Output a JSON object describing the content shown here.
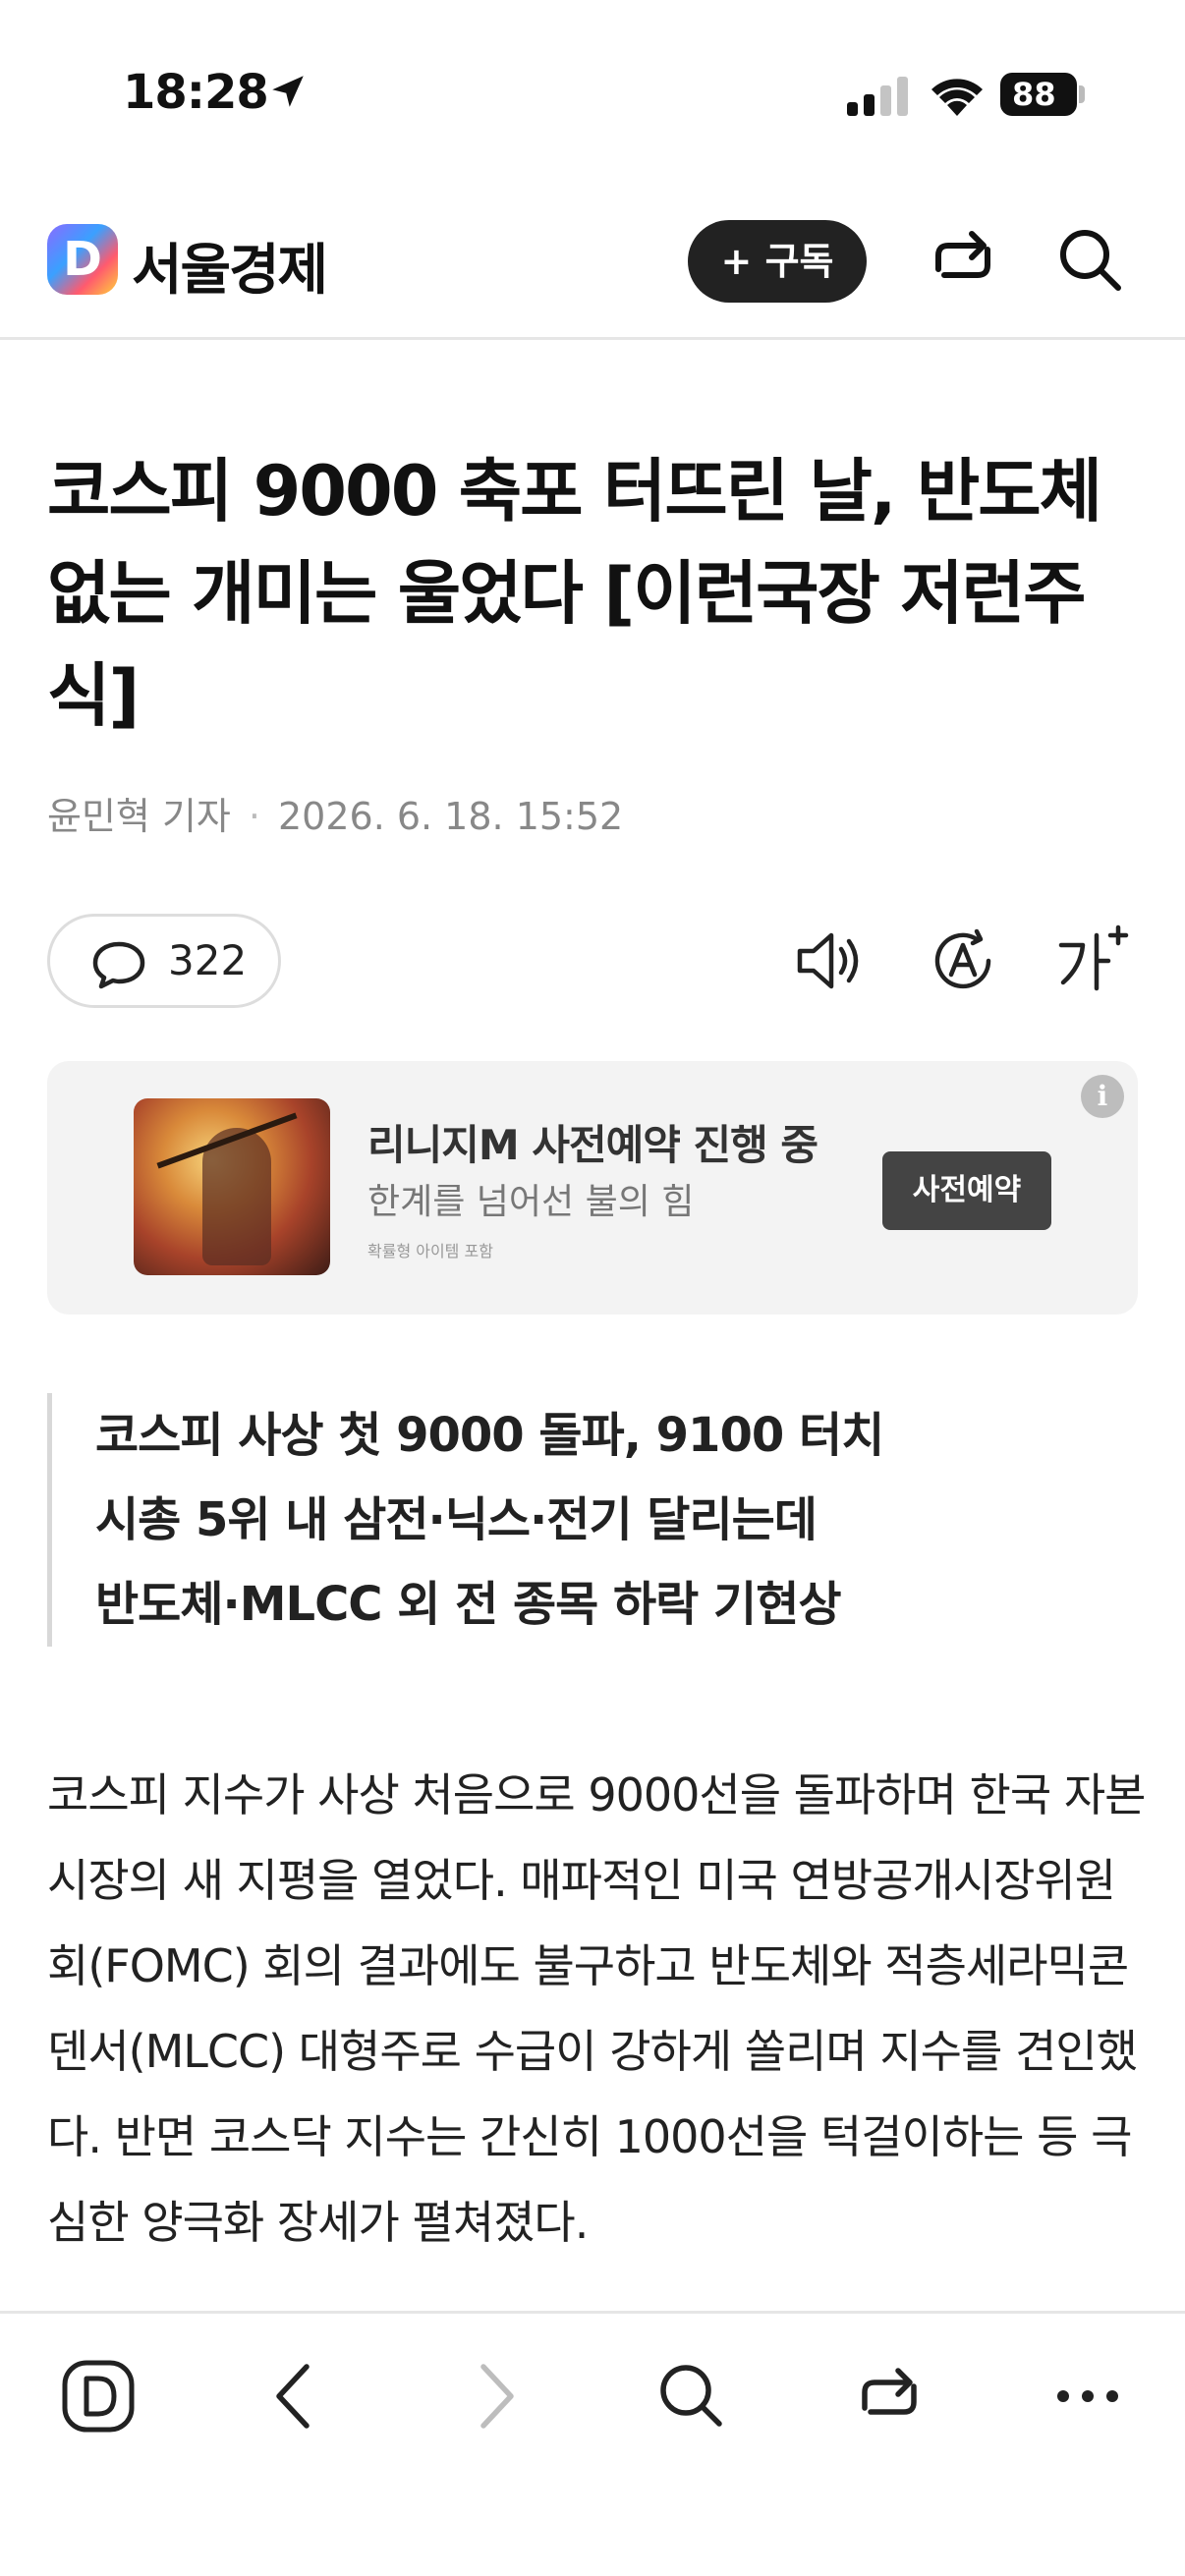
{
  "status_bar": {
    "time": "18:28",
    "battery": "88",
    "icons": [
      "location-arrow-icon",
      "signal-icon",
      "wifi-icon",
      "battery-icon"
    ]
  },
  "header": {
    "logo_letter": "D",
    "publisher": "서울경제",
    "subscribe_label": "+ 구독",
    "icons": [
      "share-icon",
      "search-icon"
    ]
  },
  "article": {
    "headline": "코스피 9000 축포 터뜨린 날, 반도체 없는 개미는 울었다 [이런국장 저런주식]",
    "author": "윤민혁 기자",
    "date": "2026. 6. 18. 15:52",
    "comment_count": "322",
    "summary": [
      "코스피 사상 첫 9000 돌파, 9100 터치",
      "시총 5위 내 삼전·닉스·전기 달리는데",
      "반도체·MLCC 외 전 종목 하락 기현상"
    ],
    "body": "코스피 지수가 사상 처음으로 9000선을 돌파하며 한국 자본시장의 새 지평을 열었다. 매파적인 미국 연방공개시장위원회(FOMC) 회의 결과에도 불구하고 반도체와 적층세라믹콘덴서(MLCC) 대형주로 수급이 강하게 쏠리며 지수를 견인했다. 반면 코스닥 지수는 간신히 1000선을 턱걸이하는 등 극심한 양극화 장세가 펼쳐졌다."
  },
  "ad": {
    "title": "리니지M 사전예약 진행 중",
    "subtitle": "한계를 넘어선 불의 힘",
    "note": "확률형 아이템 포함",
    "cta": "사전예약",
    "info_icon": "i"
  },
  "toolbar": {
    "icons": [
      "daum-home-icon",
      "back-icon",
      "forward-icon",
      "search-icon",
      "share-icon",
      "more-icon"
    ]
  },
  "colors": {
    "subscribe_bg": "#222222",
    "ad_bg": "#f3f3f3",
    "ad_cta_bg": "#444444",
    "muted_text": "#888888"
  }
}
